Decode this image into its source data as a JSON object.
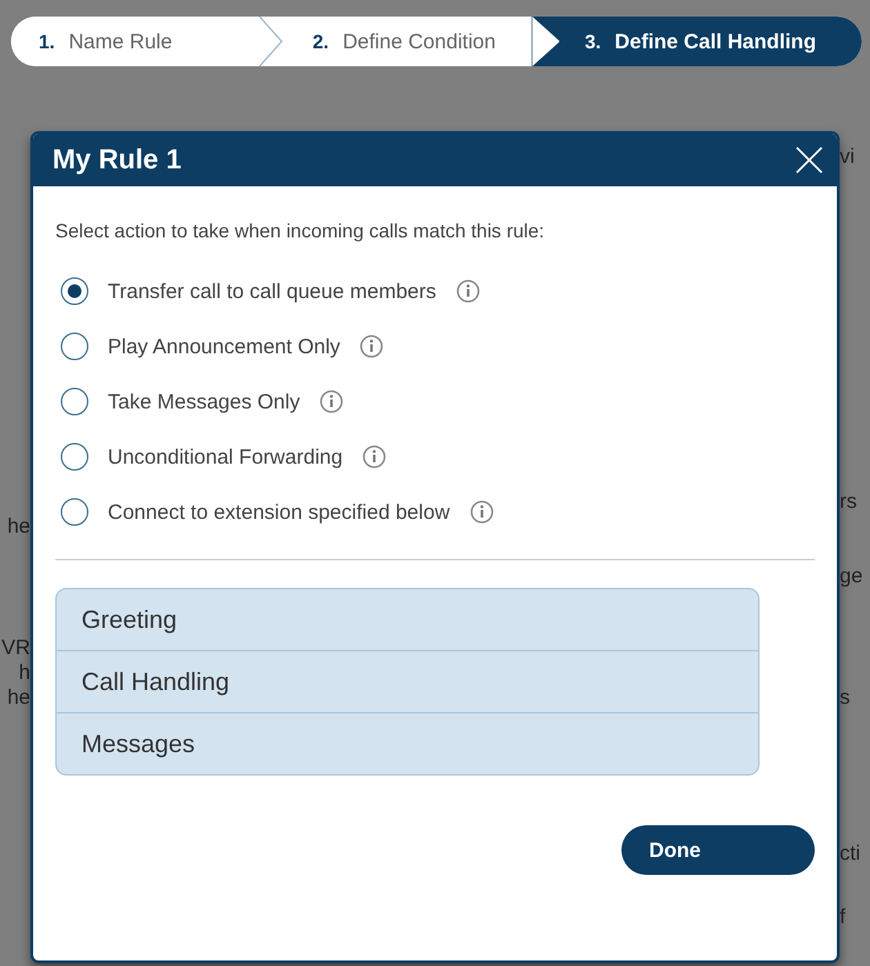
{
  "wizard": {
    "steps": [
      {
        "number": "1.",
        "label": "Name Rule",
        "selected": false
      },
      {
        "number": "2.",
        "label": "Define Condition",
        "selected": false
      },
      {
        "number": "3.",
        "label": "Define Call Handling",
        "selected": true
      }
    ]
  },
  "background": {
    "left": [
      "he",
      "VR",
      "h",
      "he"
    ],
    "right": [
      "vi",
      "rs",
      "ge",
      "s",
      "cti",
      "f"
    ]
  },
  "dialog": {
    "title": "My Rule 1",
    "prompt": "Select action to take when incoming calls match this rule:",
    "options": [
      {
        "label": "Transfer call to call queue members",
        "selected": true
      },
      {
        "label": "Play Announcement Only",
        "selected": false
      },
      {
        "label": "Take Messages Only",
        "selected": false
      },
      {
        "label": "Unconditional Forwarding",
        "selected": false
      },
      {
        "label": "Connect to extension specified below",
        "selected": false
      }
    ],
    "sections": [
      "Greeting",
      "Call Handling",
      "Messages"
    ],
    "done": "Done"
  }
}
